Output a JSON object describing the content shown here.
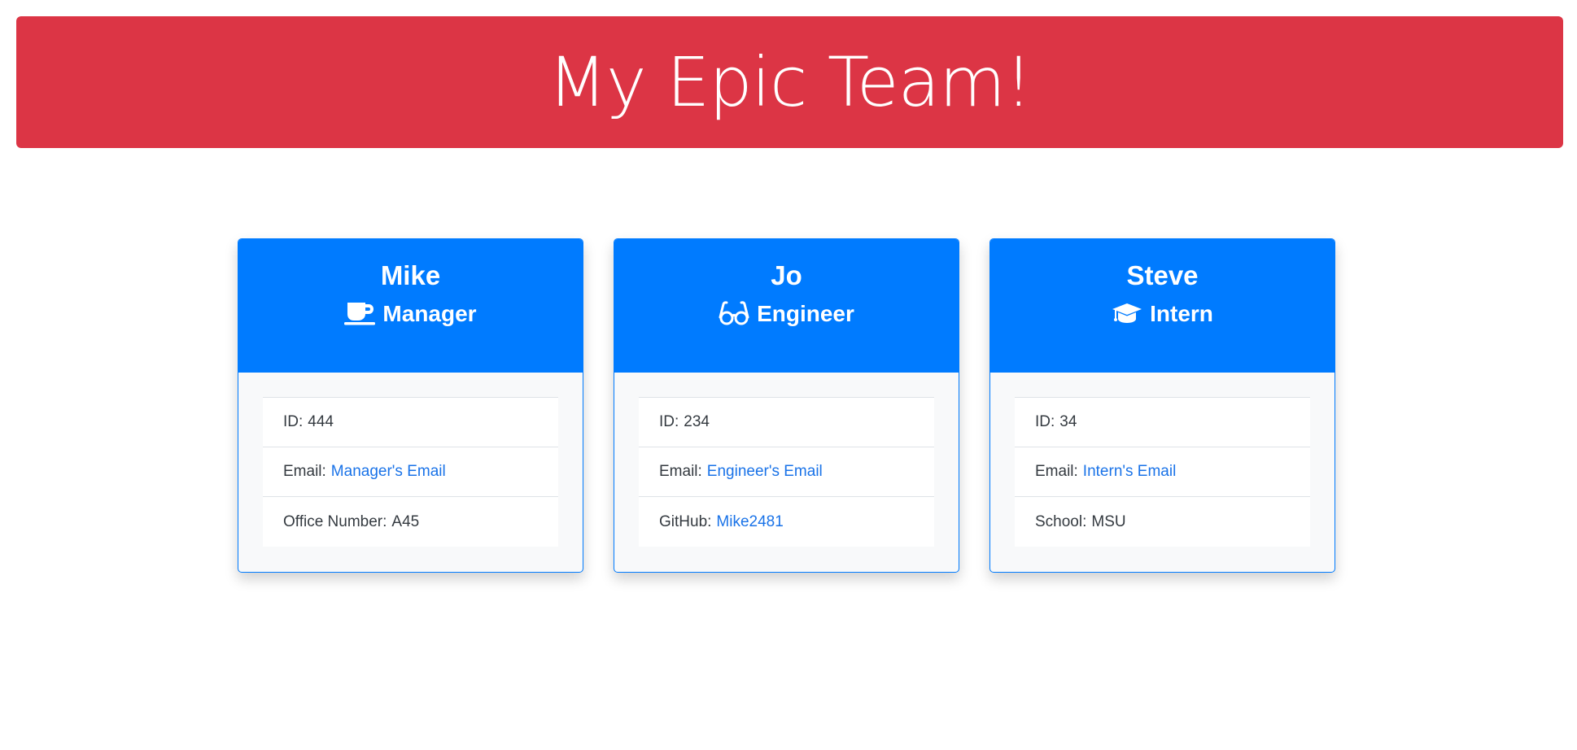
{
  "header": {
    "title": "My Epic Team!"
  },
  "colors": {
    "header_bg": "#dc3545",
    "card_accent": "#007bff",
    "link": "#1a73e8"
  },
  "employees": [
    {
      "name": "Mike",
      "role": "Manager",
      "role_icon": "coffee-icon",
      "id_label": "ID:",
      "id": "444",
      "email_label": "Email:",
      "email_link": "Manager's Email",
      "extra_label": "Office Number:",
      "extra_value": "A45"
    },
    {
      "name": "Jo",
      "role": "Engineer",
      "role_icon": "glasses-icon",
      "id_label": "ID:",
      "id": "234",
      "email_label": "Email:",
      "email_link": "Engineer's Email",
      "extra_label": "GitHub:",
      "extra_value": "Mike2481"
    },
    {
      "name": "Steve",
      "role": "Intern",
      "role_icon": "graduation-cap-icon",
      "id_label": "ID:",
      "id": "34",
      "email_label": "Email:",
      "email_link": "Intern's Email",
      "extra_label": "School:",
      "extra_value": "MSU"
    }
  ]
}
